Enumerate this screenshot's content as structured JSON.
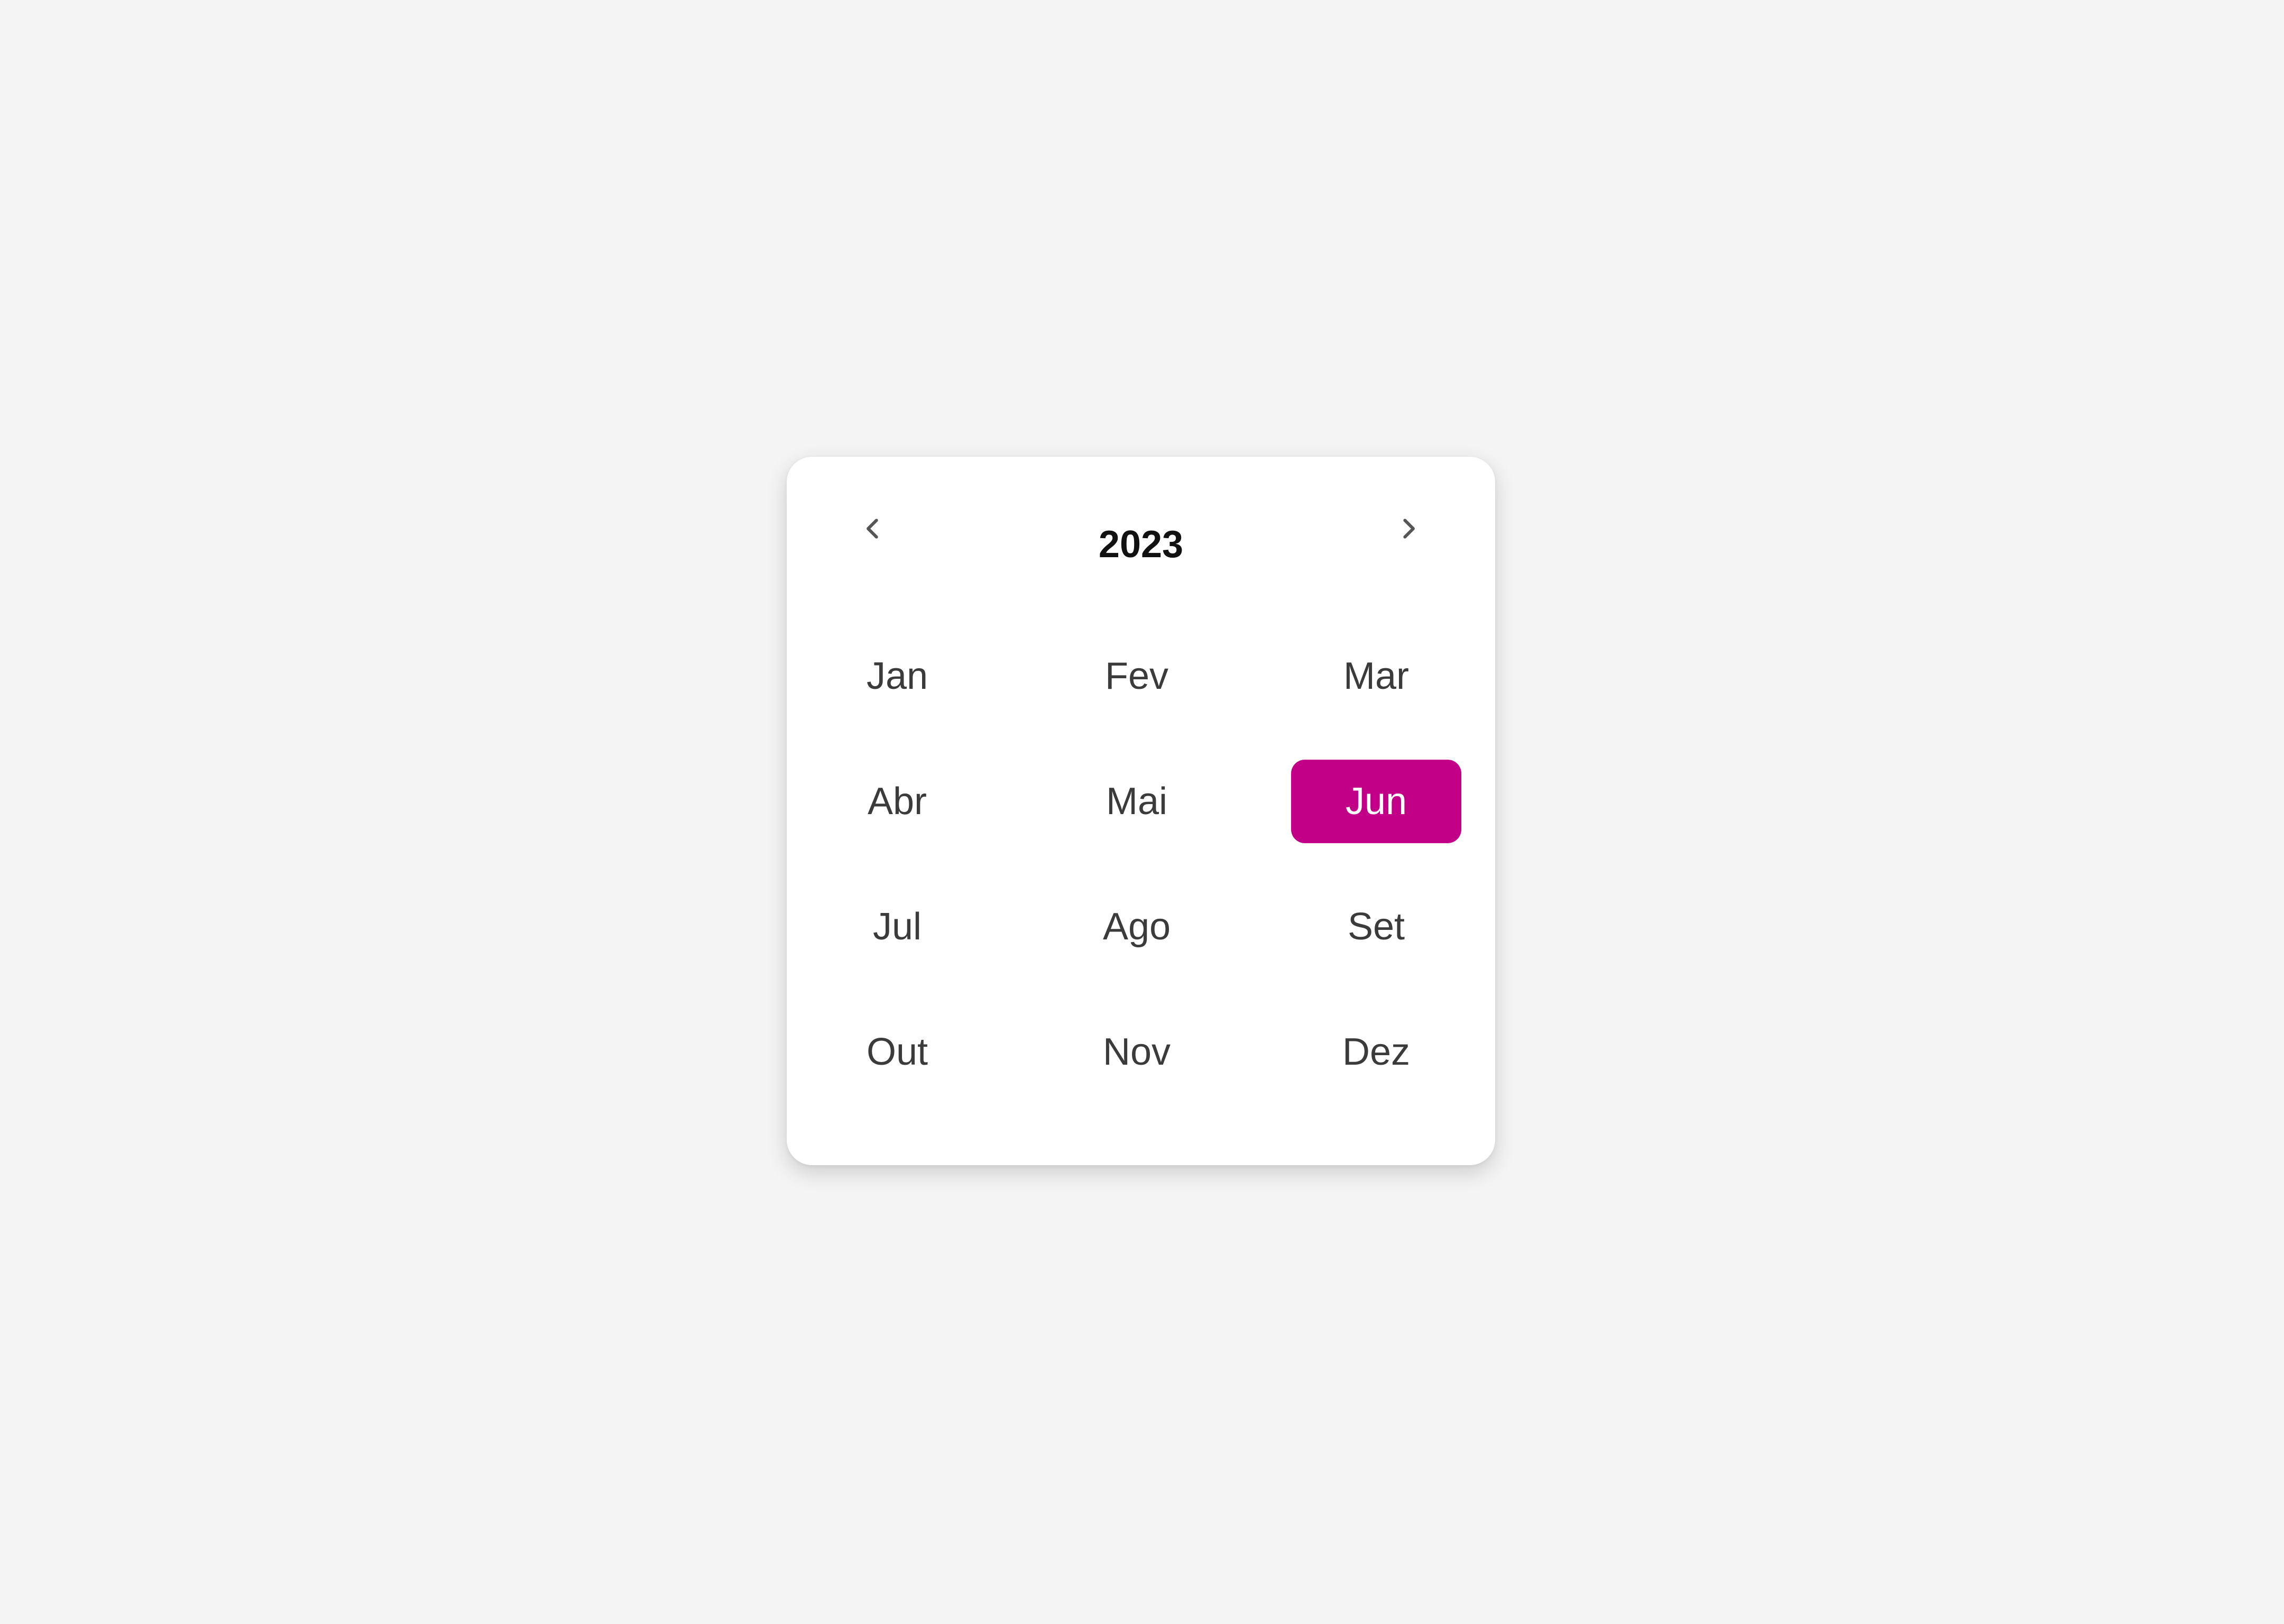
{
  "picker": {
    "year": "2023",
    "prev_icon": "chevron-left-icon",
    "next_icon": "chevron-right-icon",
    "selected_month": "Jun",
    "accent_color": "#c20087",
    "months": [
      "Jan",
      "Fev",
      "Mar",
      "Abr",
      "Mai",
      "Jun",
      "Jul",
      "Ago",
      "Set",
      "Out",
      "Nov",
      "Dez"
    ]
  }
}
